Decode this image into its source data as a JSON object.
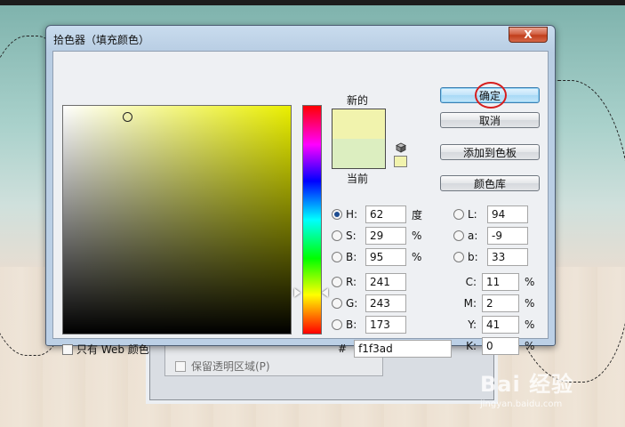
{
  "dialog": {
    "title": "拾色器（填充颜色）",
    "close_label": "X"
  },
  "preview": {
    "new_label": "新的",
    "current_label": "当前",
    "new_color": "#f1f3ad",
    "current_color": "#dceec0"
  },
  "buttons": {
    "ok": "确定",
    "cancel": "取消",
    "add_to_swatches": "添加到色板",
    "color_libraries": "颜色库"
  },
  "hsb": [
    {
      "label": "H:",
      "value": "62",
      "unit": "度",
      "selected": true
    },
    {
      "label": "S:",
      "value": "29",
      "unit": "%",
      "selected": false
    },
    {
      "label": "B:",
      "value": "95",
      "unit": "%",
      "selected": false
    }
  ],
  "rgb": [
    {
      "label": "R:",
      "value": "241"
    },
    {
      "label": "G:",
      "value": "243"
    },
    {
      "label": "B:",
      "value": "173"
    }
  ],
  "lab": [
    {
      "label": "L:",
      "value": "94"
    },
    {
      "label": "a:",
      "value": "-9"
    },
    {
      "label": "b:",
      "value": "33"
    }
  ],
  "cmyk": [
    {
      "label": "C:",
      "value": "11",
      "unit": "%"
    },
    {
      "label": "M:",
      "value": "2",
      "unit": "%"
    },
    {
      "label": "Y:",
      "value": "41",
      "unit": "%"
    },
    {
      "label": "K:",
      "value": "0",
      "unit": "%"
    }
  ],
  "hex": {
    "prefix": "#",
    "value": "f1f3ad"
  },
  "web_only_label": "只有 Web 颜色",
  "background_dialog": {
    "checkbox_label": "保留透明区域(P)"
  },
  "watermark": {
    "main": "Bai 经验",
    "sub": "jingyan.baidu.com"
  },
  "colors": {
    "field_hue": "#eaef00",
    "accent_ring": "#d61e1e"
  }
}
